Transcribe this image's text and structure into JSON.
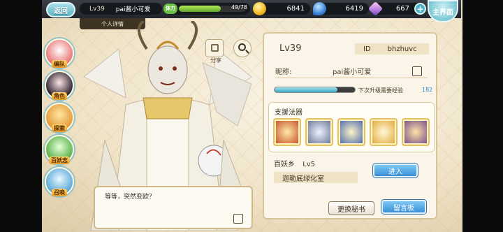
{
  "topbar": {
    "back_label": "返回",
    "level": "Lv39",
    "player_name": "pai酱小可爱",
    "stamina_label": "体力",
    "stamina_text": "49/78",
    "stamina_fraction": 0.63,
    "gold": "6841",
    "gems": "6419",
    "crystals": "667",
    "main_label": "主界面"
  },
  "tab_label": "个人详情",
  "nav": [
    {
      "label": "编队",
      "icon": "team-icon"
    },
    {
      "label": "角色",
      "icon": "character-icon"
    },
    {
      "label": "探索",
      "icon": "explore-icon"
    },
    {
      "label": "百妖志",
      "icon": "codex-icon"
    },
    {
      "label": "召唤",
      "icon": "summon-icon"
    }
  ],
  "share_label": "分享",
  "speech_text": "等等，突然变欧？",
  "panel": {
    "level": "Lv39",
    "id_label": "ID",
    "id_value": "bhzhuvc",
    "nick_label": "昵称:",
    "nickname": "pai酱小可爱",
    "exp_label": "下次升级需要经验",
    "exp_value": "182",
    "exp_fraction": 0.78,
    "artifact_title": "支援法器",
    "home_name": "百妖乡",
    "home_level": "Lv5",
    "home_place": "迦勒底绿化室",
    "enter_label": "进入",
    "swap_label": "更换秘书",
    "board_label": "留言板"
  },
  "colors": {
    "accent": "#3a8fd6",
    "panel": "#faf5e8",
    "gold": "#e6c25f"
  }
}
